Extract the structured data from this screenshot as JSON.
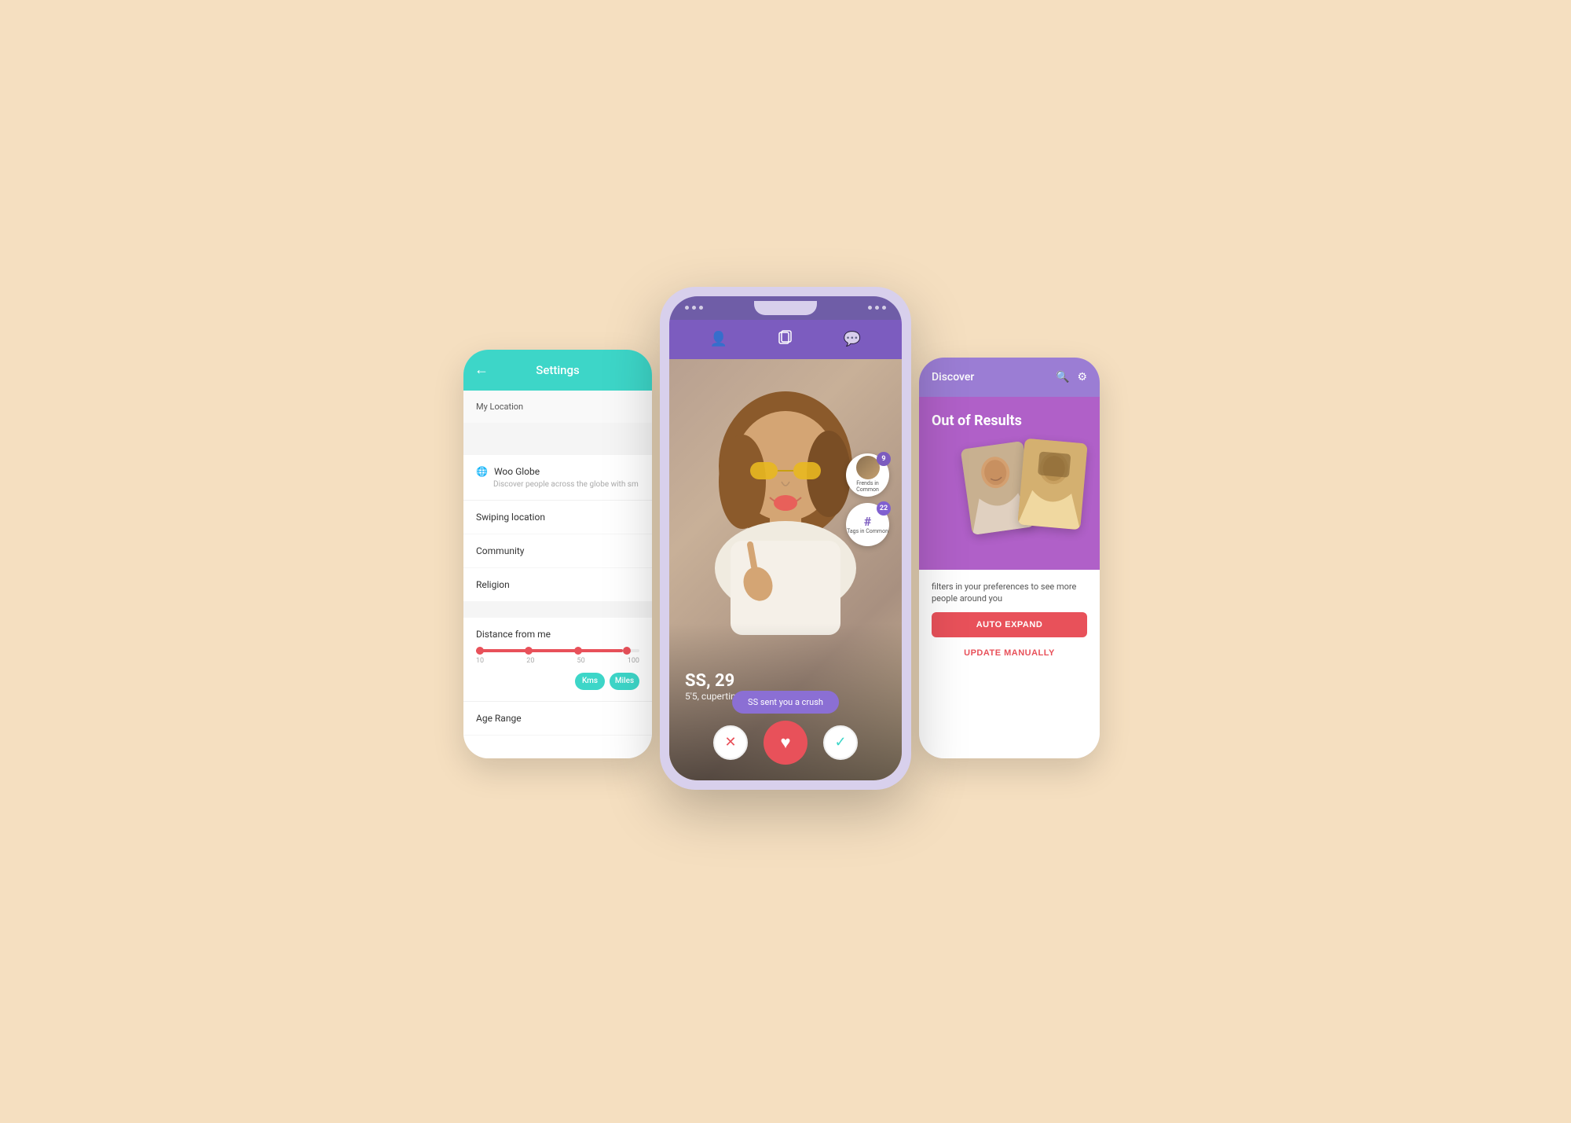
{
  "background_color": "#f5dfc0",
  "left_phone": {
    "header": {
      "title": "Settings",
      "back_label": "←"
    },
    "sections": {
      "my_location": "My Location",
      "woo_globe": {
        "title": "Woo Globe",
        "description": "Discover people across the globe with sm"
      },
      "swiping_location": "Swiping location",
      "community": "Community",
      "religion": "Religion",
      "distance_from_me": "Distance from me",
      "slider_labels": [
        "10",
        "20",
        "50",
        "100"
      ],
      "unit_kms": "Kms",
      "unit_miles": "Miles",
      "age_range": "Age Range"
    }
  },
  "center_phone": {
    "nav_icons": [
      "👤",
      "📋",
      "💬"
    ],
    "card": {
      "name": "SS, 29",
      "details": "5'5, cupertino",
      "friends_common_count": "9",
      "friends_common_label": "Frends in Common",
      "tags_common_count": "22",
      "tags_common_label": "Tags in Common",
      "crush_notification": "SS sent you a crush"
    },
    "actions": {
      "reject": "✕",
      "heart": "♥",
      "accept": "✓"
    }
  },
  "right_phone": {
    "header": {
      "title": "Discover",
      "search_icon": "🔍",
      "settings_icon": "⚙"
    },
    "body": {
      "out_of_results": "Out of Results",
      "expand_text": "filters in your preferences to see more people around you",
      "auto_expand_label": "AUTO EXPAND",
      "update_manually_label": "UPDATE MANUALLY"
    }
  }
}
